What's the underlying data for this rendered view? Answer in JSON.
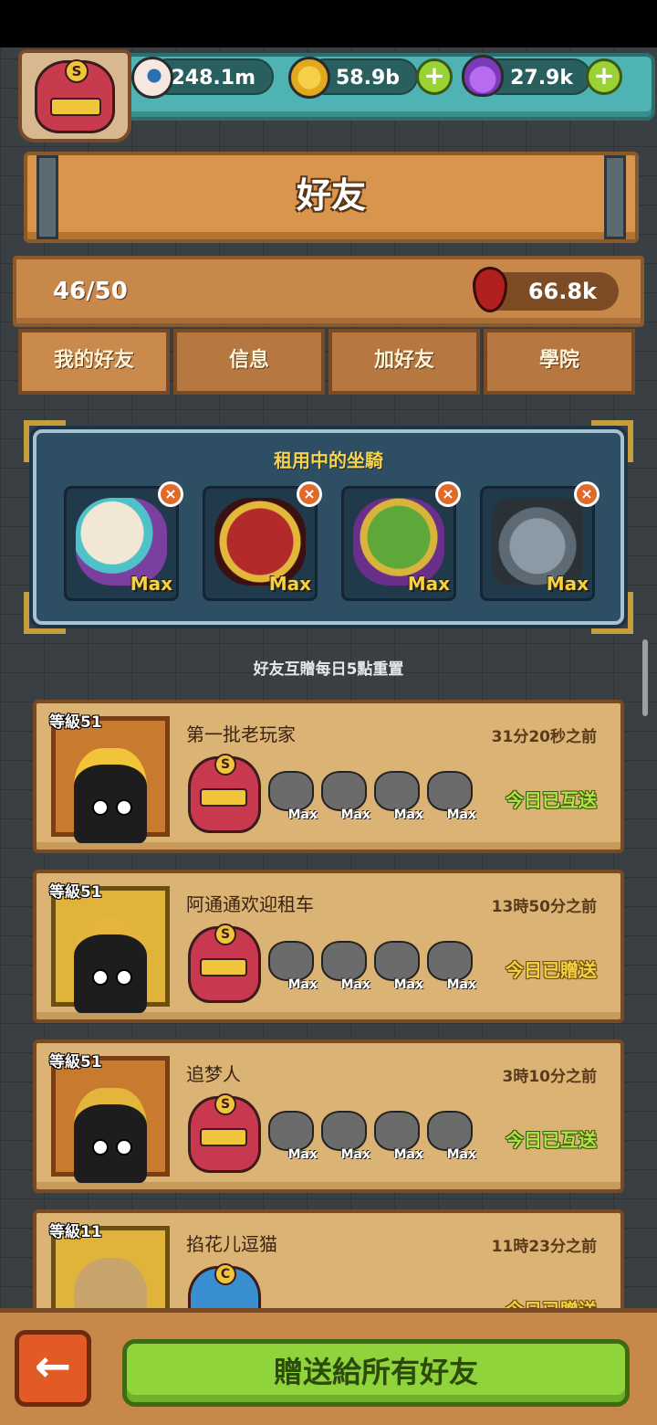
{
  "header": {
    "avatar_letter": "S",
    "resources": [
      {
        "icon": "eyeball-icon",
        "value": "248.1m"
      },
      {
        "icon": "coin-icon",
        "value": "58.9b"
      },
      {
        "icon": "potion-icon",
        "value": "27.9k"
      }
    ]
  },
  "title": "好友",
  "stats": {
    "friend_count": "46/50",
    "blood": "66.8k"
  },
  "tabs": [
    {
      "label": "我的好友",
      "active": true
    },
    {
      "label": "信息",
      "active": false
    },
    {
      "label": "加好友",
      "active": false
    },
    {
      "label": "學院",
      "active": false
    }
  ],
  "rental": {
    "title": "租用中的坐騎",
    "mounts": [
      {
        "icon": "white-beast-mount-icon",
        "label": "Max"
      },
      {
        "icon": "red-demon-mount-icon",
        "label": "Max"
      },
      {
        "icon": "green-throne-mount-icon",
        "label": "Max"
      },
      {
        "icon": "skull-machine-mount-icon",
        "label": "Max"
      }
    ]
  },
  "reset_note": "好友互贈每日5點重置",
  "friends": [
    {
      "level": "等級51",
      "name": "第一批老玩家",
      "time": "31分20秒之前",
      "status": "今日已互送",
      "avatar_letter": "S",
      "mount_labels": [
        "Max",
        "Max",
        "Max",
        "Max"
      ]
    },
    {
      "level": "等級51",
      "name": "阿通通欢迎租车",
      "time": "13時50分之前",
      "status": "今日已贈送",
      "avatar_letter": "S",
      "mount_labels": [
        "Max",
        "Max",
        "Max",
        "Max"
      ]
    },
    {
      "level": "等級51",
      "name": "追梦人",
      "time": "3時10分之前",
      "status": "今日已互送",
      "avatar_letter": "S",
      "mount_labels": [
        "Max",
        "Max",
        "Max",
        "Max"
      ]
    },
    {
      "level": "等級11",
      "name": "掐花儿逗猫",
      "time": "11時23分之前",
      "status": "今日已贈送",
      "avatar_letter": "C",
      "mount_labels": []
    }
  ],
  "bottom": {
    "back_icon": "arrow-left-icon",
    "gift_all_label": "贈送給所有好友"
  }
}
